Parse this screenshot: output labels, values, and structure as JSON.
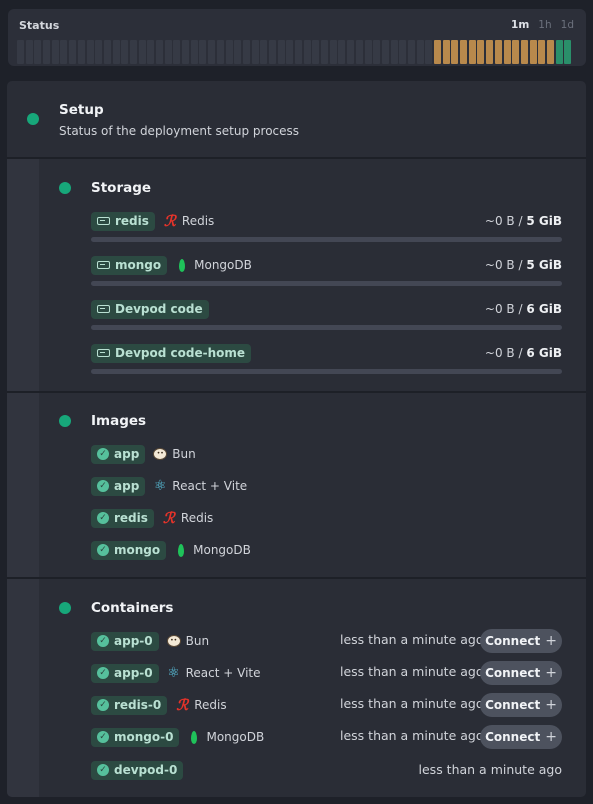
{
  "status": {
    "title": "Status",
    "ranges": [
      "1m",
      "1h",
      "1d"
    ],
    "active_range": "1m",
    "bars": {
      "idle": 48,
      "warning": 14,
      "ok": 2
    },
    "colors": {
      "idle": "#363a45",
      "warning": "#b8894c",
      "ok": "#2a8f6a"
    }
  },
  "setup": {
    "title": "Setup",
    "subtitle": "Status of the deployment setup process",
    "status_color": "#17a77a"
  },
  "storage": {
    "title": "Storage",
    "items": [
      {
        "name": "redis",
        "tech": "Redis",
        "tech_icon": "redis-icon",
        "used": "~0 B",
        "capacity": "5 GiB",
        "fill": 0
      },
      {
        "name": "mongo",
        "tech": "MongoDB",
        "tech_icon": "mongodb-icon",
        "used": "~0 B",
        "capacity": "5 GiB",
        "fill": 0
      },
      {
        "name": "Devpod code",
        "tech": "",
        "used": "~0 B",
        "capacity": "6 GiB",
        "fill": 0
      },
      {
        "name": "Devpod code-home",
        "tech": "",
        "used": "~0 B",
        "capacity": "6 GiB",
        "fill": 0
      }
    ],
    "sep": "/"
  },
  "images": {
    "title": "Images",
    "items": [
      {
        "name": "app",
        "tech": "Bun",
        "tech_icon": "bun-icon"
      },
      {
        "name": "app",
        "tech": "React + Vite",
        "tech_icon": "react-icon"
      },
      {
        "name": "redis",
        "tech": "Redis",
        "tech_icon": "redis-icon"
      },
      {
        "name": "mongo",
        "tech": "MongoDB",
        "tech_icon": "mongodb-icon"
      }
    ]
  },
  "containers": {
    "title": "Containers",
    "connect_label": "Connect",
    "items": [
      {
        "name": "app-0",
        "tech": "Bun",
        "tech_icon": "bun-icon",
        "time": "less than a minute ago",
        "connect": true
      },
      {
        "name": "app-0",
        "tech": "React + Vite",
        "tech_icon": "react-icon",
        "time": "less than a minute ago",
        "connect": true
      },
      {
        "name": "redis-0",
        "tech": "Redis",
        "tech_icon": "redis-icon",
        "time": "less than a minute ago",
        "connect": true
      },
      {
        "name": "mongo-0",
        "tech": "MongoDB",
        "tech_icon": "mongodb-icon",
        "time": "less than a minute ago",
        "connect": true
      },
      {
        "name": "devpod-0",
        "tech": "",
        "time": "less than a minute ago",
        "connect": false
      }
    ]
  }
}
